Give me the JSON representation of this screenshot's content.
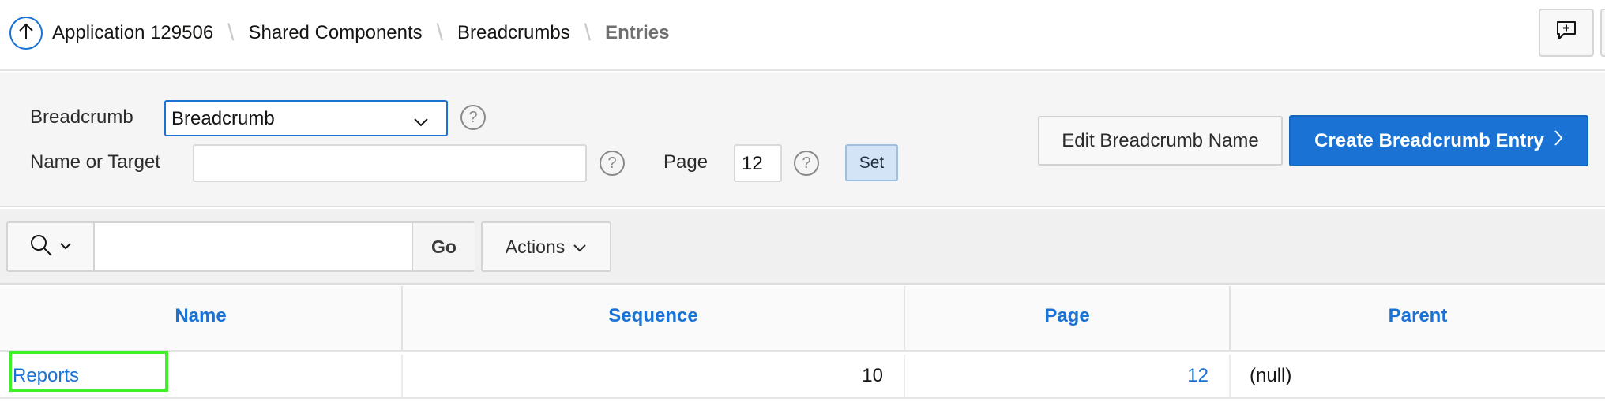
{
  "breadcrumb": {
    "items": [
      "Application 129506",
      "Shared Components",
      "Breadcrumbs"
    ],
    "current": "Entries"
  },
  "filters": {
    "breadcrumb_label": "Breadcrumb",
    "breadcrumb_value": "Breadcrumb",
    "name_label": "Name or Target",
    "name_value": "",
    "page_label": "Page",
    "page_value": "12",
    "help_glyph": "?",
    "set_label": "Set"
  },
  "buttons": {
    "edit_label": "Edit Breadcrumb Name",
    "create_label": "Create Breadcrumb Entry"
  },
  "report_toolbar": {
    "search_value": "",
    "go_label": "Go",
    "actions_label": "Actions"
  },
  "table": {
    "columns": [
      "Name",
      "Sequence",
      "Page",
      "Parent"
    ],
    "rows": [
      {
        "name": "Reports",
        "sequence": "10",
        "page": "12",
        "parent": "(null)"
      }
    ]
  },
  "colors": {
    "accent": "#1a72d4",
    "highlight": "#3fef2a"
  },
  "icons": {
    "up": "arrow-up-icon",
    "feedback": "chat-plus-icon",
    "search": "search-icon",
    "chevron": "chevron-down-icon",
    "chevron_right": "chevron-right-icon"
  }
}
